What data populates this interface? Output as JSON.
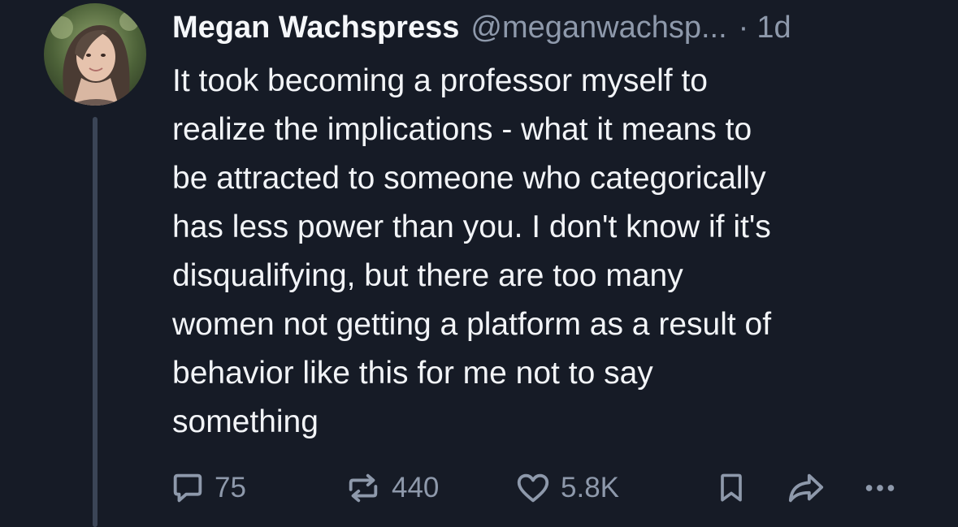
{
  "tweet": {
    "author": {
      "name": "Megan Wachspress",
      "handle": "@meganwachsp...",
      "avatar_icon": "profile-photo"
    },
    "separator": "·",
    "time": "1d",
    "text_lines": [
      "It took becoming a professor myself to",
      "realize the implications - what it means to",
      "be attracted to someone who categorically",
      "has less power than you. I don't know if it's",
      "disqualifying, but there are too many",
      "women not getting a platform as a result of",
      "behavior like this for me not to say",
      "something"
    ],
    "actions": {
      "replies": {
        "icon": "comment-icon",
        "count": "75"
      },
      "reposts": {
        "icon": "repost-icon",
        "count": "440"
      },
      "likes": {
        "icon": "heart-icon",
        "count": "5.8K"
      },
      "bookmark": {
        "icon": "bookmark-icon"
      },
      "share": {
        "icon": "share-icon"
      },
      "more": {
        "icon": "more-icon"
      }
    }
  },
  "colors": {
    "background": "#161b26",
    "text_primary": "#f2f4f7",
    "text_secondary": "#8e99ab",
    "icon": "#8e99ab",
    "thread_line": "#3b4556"
  }
}
